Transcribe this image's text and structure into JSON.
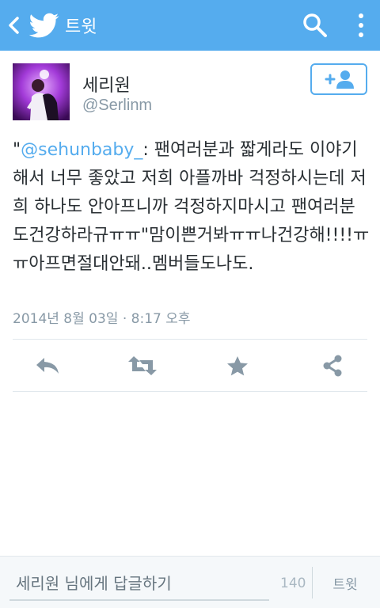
{
  "appbar": {
    "title": "트윗",
    "color": "#55acee",
    "icons": [
      "back-chevron-icon",
      "twitter-bird-icon",
      "search-icon",
      "overflow-menu-icon"
    ]
  },
  "author": {
    "name": "세리원",
    "handle": "@Serlinm",
    "follow_icon": "add-user-icon"
  },
  "tweet": {
    "open_quote": "\"",
    "mention": "@sehunbaby_",
    "text": ": 팬여러분과 짧게라도 이야기해서 너무 좋았고 저희 아플까바 걱정하시는데 저희 하나도 안아프니까 걱정하지마시고 팬여러분도건강하라규ㅠㅠ\"맘이쁜거봐ㅠㅠ나건강해!!!!ㅠㅠ아프면절대안돼..멤버들도나도.",
    "timestamp": "2014년 8월 03일 · 8:17 오후"
  },
  "actions": {
    "reply_icon": "reply-icon",
    "retweet_icon": "retweet-icon",
    "favorite_icon": "star-icon",
    "share_icon": "share-icon"
  },
  "compose": {
    "placeholder": "세리원 님에게 답글하기",
    "value": "",
    "char_count": "140",
    "tweet_label": "트윗"
  }
}
